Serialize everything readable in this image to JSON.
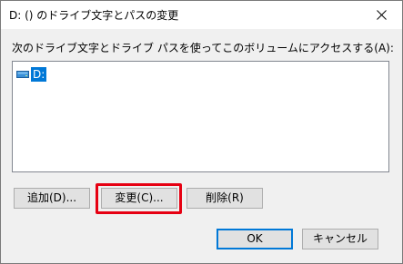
{
  "window": {
    "title": "D: () のドライブ文字とパスの変更",
    "close_icon": "close-icon"
  },
  "dialog": {
    "prompt": "次のドライブ文字とドライブ パスを使ってこのボリュームにアクセスする(A):",
    "list": {
      "items": [
        {
          "icon": "drive-icon",
          "label": "D:",
          "selected": true
        }
      ]
    },
    "buttons": {
      "add": "追加(D)...",
      "change": "変更(C)...",
      "remove": "削除(R)",
      "ok": "OK",
      "cancel": "キャンセル"
    }
  },
  "colors": {
    "selection": "#0078d7",
    "highlight": "#e60012",
    "button_face": "#e1e1e1",
    "dialog_bg": "#f0f0f0"
  }
}
